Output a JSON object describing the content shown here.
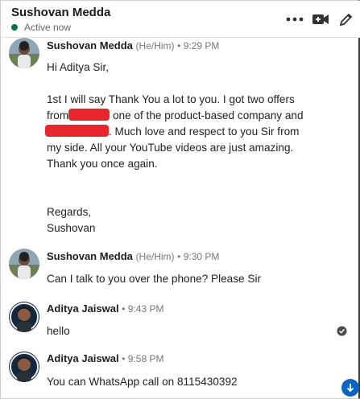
{
  "header": {
    "name": "Sushovan Medda",
    "status": "Active now",
    "icons": [
      "more-icon",
      "video-call-icon",
      "compose-icon"
    ]
  },
  "messages": [
    {
      "sender": "Sushovan Medda",
      "pronouns": "(He/Him)",
      "time": "• 9:29 PM",
      "lines": {
        "greeting": "Hi Aditya Sir,",
        "p1_a": "1st I will say Thank You a lot to you. I got two offers",
        "p1_b_pre": "from",
        "p1_b_post": "one of the product-based company and",
        "p1_c_post": ". Much love and respect to you Sir from",
        "p1_d": "my side. All your YouTube videos are just amazing.",
        "p1_e": "Thank you once again.",
        "regards": "Regards,",
        "signoff": "Sushovan"
      }
    },
    {
      "sender": "Sushovan Medda",
      "pronouns": "(He/Him)",
      "time": "• 9:30 PM",
      "text": "Can I talk to you over the phone? Please Sir"
    },
    {
      "sender": "Aditya Jaiswal",
      "time": "• 9:43 PM",
      "text": "hello"
    },
    {
      "sender": "Aditya Jaiswal",
      "time": "• 9:58 PM",
      "text": "You can WhatsApp call on 8115430392"
    }
  ],
  "colors": {
    "active": "#057642",
    "redaction": "#e8262d",
    "accent": "#0a66c2"
  }
}
